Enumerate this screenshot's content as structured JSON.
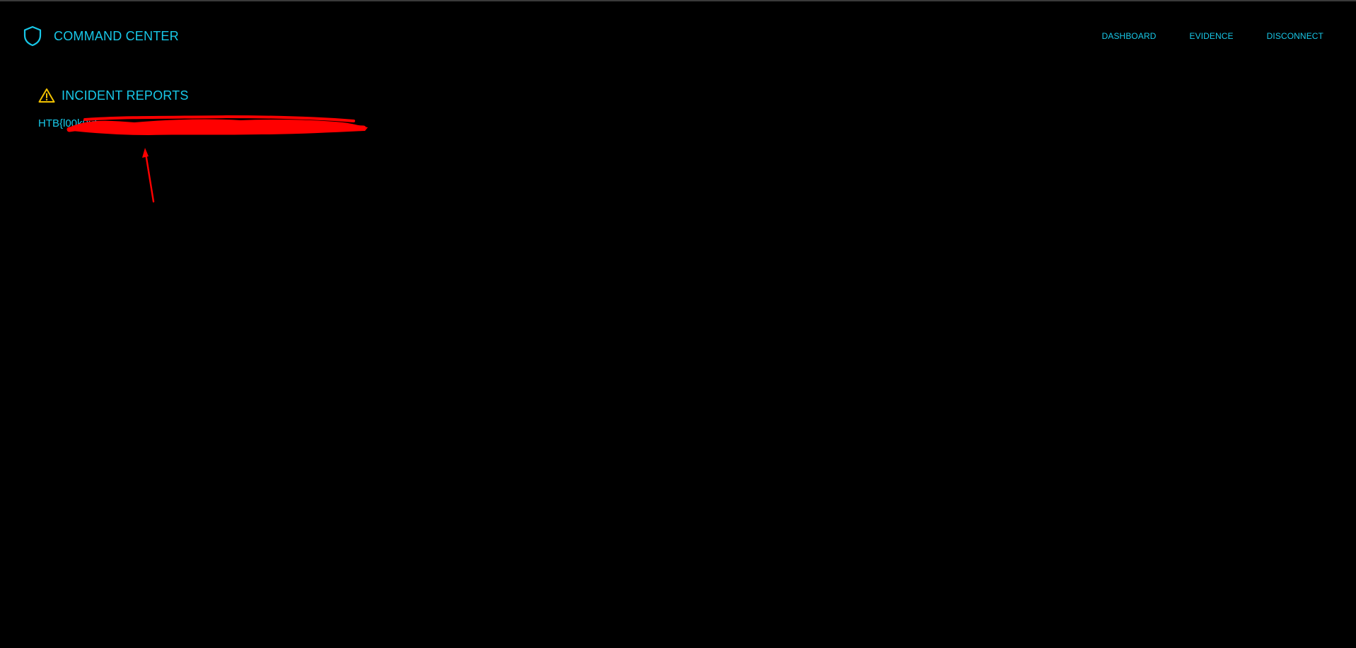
{
  "header": {
    "brand_title": "COMMAND CENTER",
    "brand_icon": "shield-icon",
    "nav": [
      {
        "label": "DASHBOARD"
      },
      {
        "label": "EVIDENCE"
      },
      {
        "label": "DISCONNECT"
      }
    ]
  },
  "incidents": {
    "title": "INCIDENT REPORTS",
    "title_icon": "warning-icon",
    "flag_visible": "HTB{l00k0ut_"
  },
  "colors": {
    "background": "#000000",
    "accent": "#18c8e8",
    "warning": "#f2c200",
    "redaction": "#ff0000"
  }
}
